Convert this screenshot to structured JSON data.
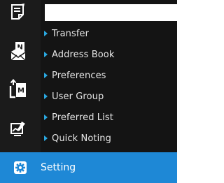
{
  "rail": {
    "icons": [
      {
        "name": "note-icon"
      },
      {
        "name": "mail-n-icon"
      },
      {
        "name": "transfer-m-icon"
      },
      {
        "name": "chart-edit-icon"
      }
    ]
  },
  "submenu": {
    "items": [
      {
        "label": "Transfer"
      },
      {
        "label": "Address Book"
      },
      {
        "label": "Preferences"
      },
      {
        "label": "User Group"
      },
      {
        "label": "Preferred List"
      },
      {
        "label": "Quick Noting"
      }
    ]
  },
  "setting": {
    "label": "Setting",
    "icon": "gear-icon"
  },
  "colors": {
    "rail_bg": "#1b1b1b",
    "submenu_bg": "#141414",
    "caret": "#2aa8e0",
    "active_bg": "#1e88d6",
    "text": "#e6e6e6"
  }
}
